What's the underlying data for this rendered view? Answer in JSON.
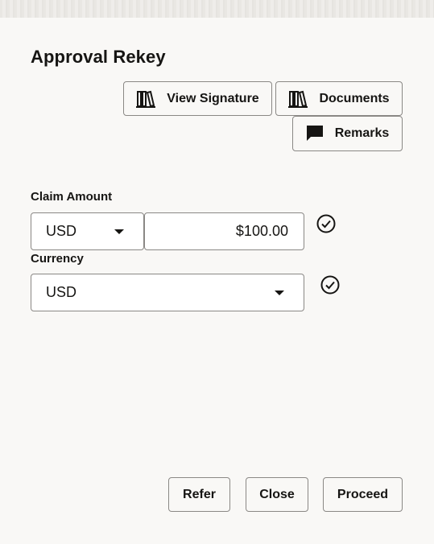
{
  "dialog": {
    "title": "Approval Rekey"
  },
  "toolbar": {
    "view_signature": {
      "label": "View Signature",
      "icon": "library-books-icon"
    },
    "documents": {
      "label": "Documents",
      "icon": "library-books-icon"
    },
    "remarks": {
      "label": "Remarks",
      "icon": "speech-bubble-icon"
    }
  },
  "form": {
    "claim_amount": {
      "label": "Claim Amount",
      "currency": "USD",
      "value": "$100.00",
      "status_icon": "check-circle-icon"
    },
    "currency": {
      "label": "Currency",
      "value": "USD",
      "status_icon": "check-circle-icon"
    }
  },
  "footer": {
    "refer": "Refer",
    "close": "Close",
    "proceed": "Proceed"
  }
}
